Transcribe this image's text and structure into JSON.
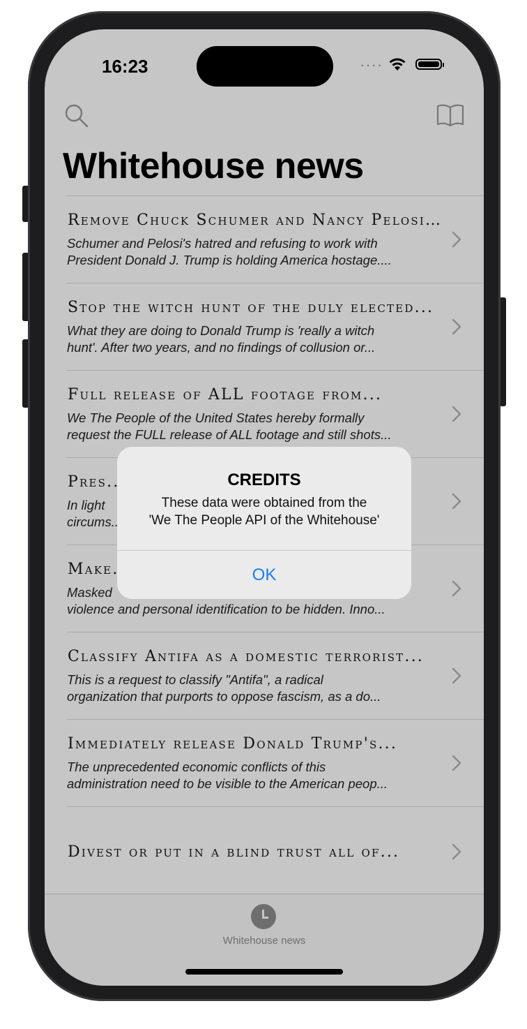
{
  "status": {
    "time": "16:23",
    "signal": "····"
  },
  "header": {
    "title": "Whitehouse news"
  },
  "items": [
    {
      "title": "Remove Chuck Schumer and Nancy Pelosi...",
      "line1": "Schumer and Pelosi's hatred and refusing to work with",
      "line2": "President Donald J. Trump is holding America hostage...."
    },
    {
      "title": "Stop the witch hunt of the duly elected...",
      "line1": "What they are doing to Donald Trump is 'really a witch",
      "line2": "hunt'.  After two years, and no findings of collusion or..."
    },
    {
      "title": "Full release of ALL footage from...",
      "line1": "We The People of the United States hereby formally",
      "line2": "request the FULL release of ALL footage and still shots..."
    },
    {
      "title": "Pres...",
      "line1": "In light",
      "line2": "circums..."
    },
    {
      "title": "Make...",
      "line1": "Masked",
      "line2": "violence and personal identification to be hidden. Inno..."
    },
    {
      "title": "Classify Antifa as a domestic terrorist...",
      "line1": "This is a request to classify \"Antifa\", a radical",
      "line2": "organization that purports to oppose fascism, as a do..."
    },
    {
      "title": "Immediately release Donald Trump's...",
      "line1": "The unprecedented economic conflicts of this",
      "line2": "administration need to be visible to the American peop..."
    },
    {
      "title": "Divest or put in a blind trust all of..."
    }
  ],
  "alert": {
    "title": "CREDITS",
    "line1": "These data were obtained from the",
    "line2": "'We The People API of the Whitehouse'",
    "ok": "OK"
  },
  "tabbar": {
    "label": "Whitehouse news"
  }
}
